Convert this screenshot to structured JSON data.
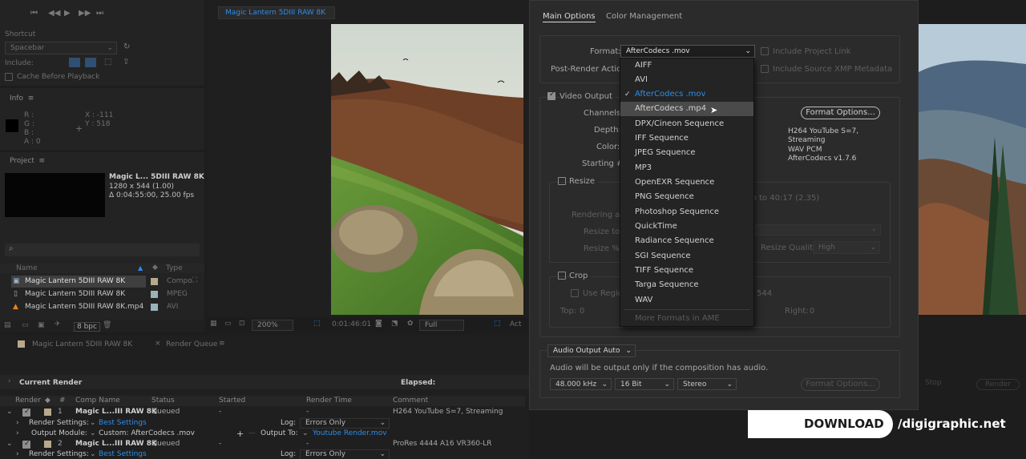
{
  "preview": {
    "shortcut_label": "Shortcut",
    "shortcut_value": "Spacebar",
    "include_label": "Include:",
    "cache_label": "Cache Before Playback"
  },
  "info": {
    "title": "Info",
    "r": "R :",
    "g": "G :",
    "b": "B :",
    "a": "A :  0",
    "x": "X : -111",
    "y": "Y : 518"
  },
  "project": {
    "title": "Project",
    "item_name": "Magic L... 5DIII RAW 8K ▾",
    "item_size": "1280 x 544 (1.00)",
    "item_duration": "Δ 0:04:55:00, 25.00 fps",
    "search_placeholder": "",
    "columns": {
      "name": "Name",
      "type": "Type"
    },
    "items": [
      {
        "name": "Magic Lantern 5DIII RAW 8K",
        "type": "Compo",
        "color": "#b8a98a"
      },
      {
        "name": "Magic Lantern 5DIII RAW 8K",
        "type": "MPEG",
        "color": "#9bb2b8"
      },
      {
        "name": "Magic Lantern 5DIII RAW 8K.mp4",
        "type": "AVI",
        "color": "#9bb2b8"
      }
    ],
    "bpc": "8 bpc"
  },
  "viewer": {
    "tab_label": "Magic Lantern 5DIII RAW 8K",
    "zoom": "200%",
    "timecode": "0:01:46:01",
    "quality": "Full",
    "active_label": "Act"
  },
  "render_queue": {
    "tab_comp": "Magic Lantern 5DIII RAW 8K",
    "tab_rq": "Render Queue",
    "current_render": "Current Render",
    "elapsed": "Elapsed:",
    "columns": {
      "render": "Render",
      "num": "#",
      "comp": "Comp Name",
      "status": "Status",
      "started": "Started",
      "render_time": "Render Time",
      "comment": "Comment"
    },
    "items": [
      {
        "num": "1",
        "comp": "Magic L...III RAW 8K",
        "status": "Queued",
        "started": "-",
        "render_time": "-",
        "comment": "H264 YouTube S=7, Streaming",
        "render_settings_label": "Render Settings:",
        "render_settings": "Best Settings",
        "log_label": "Log:",
        "log": "Errors Only",
        "output_module_label": "Output Module:",
        "output_module": "Custom: AfterCodecs .mov",
        "output_to_label": "Output To:",
        "output_to": "Youtube Render.mov"
      },
      {
        "num": "2",
        "comp": "Magic L...III RAW 8K",
        "status": "Queued",
        "started": "-",
        "render_time": "-",
        "comment": "ProRes 4444 A16 VR360-LR",
        "render_settings_label": "Render Settings:",
        "render_settings": "Best Settings",
        "log_label": "Log:",
        "log": "Errors Only"
      }
    ],
    "stop_label": "Stop",
    "render_label": "Render"
  },
  "dialog": {
    "tab_main": "Main Options",
    "tab_color": "Color Management",
    "format_label": "Format:",
    "format_value": "AfterCodecs .mov",
    "post_render_label": "Post-Render Action:",
    "include_project_link": "Include Project Link",
    "include_xmp": "Include Source XMP Metadata",
    "video_output": "Video Output",
    "channels_label": "Channels:",
    "depth_label": "Depth:",
    "color_label": "Color:",
    "starting_label": "Starting #:",
    "format_options_btn": "Format Options...",
    "format_info": [
      "H264 YouTube S=7,",
      "Streaming",
      "WAV PCM",
      "AfterCodecs v1.7.6"
    ],
    "resize": "Resize",
    "rendering_at": "Rendering at:",
    "resize_to": "Resize to:",
    "resize_pct": "Resize %:",
    "ratio_text": "tio to 40:17 (2.35)",
    "resize_quality_label": "Resize Quality:",
    "resize_quality": "High",
    "crop": "Crop",
    "use_region": "Use Region",
    "crop_544": "544",
    "top_label": "Top:",
    "top_val": "0",
    "right_label": "Right:",
    "right_val": "0",
    "audio_output": "Audio Output Auto",
    "audio_note": "Audio will be output only if the composition has audio.",
    "sample_rate": "48.000 kHz",
    "bit_depth": "16 Bit",
    "channels_audio": "Stereo",
    "audio_format_options": "Format Options..."
  },
  "format_menu": {
    "items": [
      {
        "label": "AIFF",
        "state": "normal"
      },
      {
        "label": "AVI",
        "state": "normal"
      },
      {
        "label": "AfterCodecs .mov",
        "state": "selected"
      },
      {
        "label": "AfterCodecs .mp4",
        "state": "hover"
      },
      {
        "label": "DPX/Cineon Sequence",
        "state": "normal"
      },
      {
        "label": "IFF Sequence",
        "state": "normal"
      },
      {
        "label": "JPEG Sequence",
        "state": "normal"
      },
      {
        "label": "MP3",
        "state": "normal"
      },
      {
        "label": "OpenEXR Sequence",
        "state": "normal"
      },
      {
        "label": "PNG Sequence",
        "state": "normal"
      },
      {
        "label": "Photoshop Sequence",
        "state": "normal"
      },
      {
        "label": "QuickTime",
        "state": "normal"
      },
      {
        "label": "Radiance Sequence",
        "state": "normal"
      },
      {
        "label": "SGI Sequence",
        "state": "normal"
      },
      {
        "label": "TIFF Sequence",
        "state": "normal"
      },
      {
        "label": "Targa Sequence",
        "state": "normal"
      },
      {
        "label": "WAV",
        "state": "normal"
      },
      {
        "label": "More Formats in AME",
        "state": "disabled"
      }
    ]
  },
  "banner": {
    "download": "DOWNLOAD",
    "site": "/digigraphic.net"
  },
  "colors": {
    "accent_blue": "#2d8ceb",
    "panel_bg": "#232323",
    "dialog_bg": "#2b2b2b"
  }
}
